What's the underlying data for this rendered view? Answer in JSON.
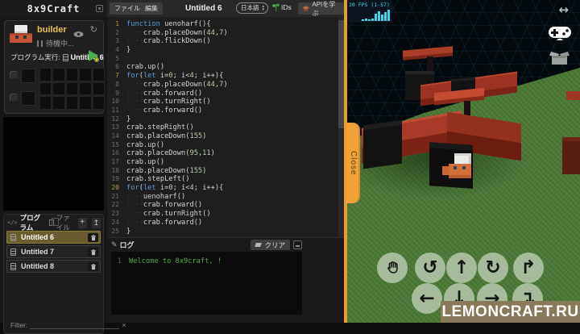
{
  "app": {
    "logo": "8x9Craft"
  },
  "menubar": {
    "file": "ファイル",
    "edit": "編集",
    "title": "Untitled 6",
    "language": "日本語",
    "ids": "IDs",
    "learn_api": "APIを学ぶ"
  },
  "sidebar": {
    "robot": {
      "name": "builder",
      "status": "待機中...",
      "refresh_glyph": "↻"
    },
    "run": {
      "label": "プログラム実行:",
      "program": "Untitled 6"
    },
    "panel": {
      "code_glyph": "</>",
      "tab_program": "プログラム",
      "tab_file": "ファイル",
      "add_label": "+",
      "upload_glyph": "↥",
      "programs": [
        {
          "name": "Untitled 6",
          "selected": true
        },
        {
          "name": "Untitled 7",
          "selected": false
        },
        {
          "name": "Untitled 8",
          "selected": false
        }
      ],
      "filter_label": "Filter:",
      "filter_clear": "×"
    }
  },
  "editor": {
    "lines": [
      {
        "n": 1,
        "hl": true,
        "t": [
          [
            "k",
            "function"
          ],
          [
            "t",
            " uenoharf(){"
          ]
        ]
      },
      {
        "n": 2,
        "t": [
          [
            "w",
            "····"
          ],
          [
            "t",
            "crab.placeDown("
          ],
          [
            "n",
            "44"
          ],
          [
            "t",
            ","
          ],
          [
            "n",
            "7"
          ],
          [
            "t",
            ")"
          ]
        ]
      },
      {
        "n": 3,
        "t": [
          [
            "w",
            "····"
          ],
          [
            "t",
            "crab.flickDown()"
          ]
        ]
      },
      {
        "n": 4,
        "t": [
          [
            "t",
            "}"
          ]
        ]
      },
      {
        "n": 5,
        "t": []
      },
      {
        "n": 6,
        "t": [
          [
            "t",
            "crab.up()"
          ]
        ]
      },
      {
        "n": 7,
        "hl": true,
        "t": [
          [
            "k",
            "for"
          ],
          [
            "t",
            "("
          ],
          [
            "k",
            "let"
          ],
          [
            "t",
            " i="
          ],
          [
            "n",
            "0"
          ],
          [
            "t",
            "; i<"
          ],
          [
            "n",
            "4"
          ],
          [
            "t",
            "; i++){"
          ]
        ]
      },
      {
        "n": 8,
        "t": [
          [
            "w",
            "····"
          ],
          [
            "t",
            "crab.placeDown("
          ],
          [
            "n",
            "44"
          ],
          [
            "t",
            ","
          ],
          [
            "n",
            "7"
          ],
          [
            "t",
            ")"
          ]
        ]
      },
      {
        "n": 9,
        "t": [
          [
            "w",
            "····"
          ],
          [
            "t",
            "crab.forward()"
          ]
        ]
      },
      {
        "n": 10,
        "t": [
          [
            "w",
            "····"
          ],
          [
            "t",
            "crab.turnRight()"
          ]
        ]
      },
      {
        "n": 11,
        "t": [
          [
            "w",
            "····"
          ],
          [
            "t",
            "crab.forward()"
          ]
        ]
      },
      {
        "n": 12,
        "t": [
          [
            "t",
            "}"
          ]
        ]
      },
      {
        "n": 13,
        "t": [
          [
            "t",
            "crab.stepRight()"
          ]
        ]
      },
      {
        "n": 14,
        "t": [
          [
            "t",
            "crab.placeDown("
          ],
          [
            "n",
            "155"
          ],
          [
            "t",
            ")"
          ]
        ]
      },
      {
        "n": 15,
        "t": [
          [
            "t",
            "crab.up()"
          ]
        ]
      },
      {
        "n": 16,
        "t": [
          [
            "t",
            "crab.placeDown("
          ],
          [
            "n",
            "95"
          ],
          [
            "t",
            ","
          ],
          [
            "n",
            "11"
          ],
          [
            "t",
            ")"
          ]
        ]
      },
      {
        "n": 17,
        "t": [
          [
            "t",
            "crab.up()"
          ]
        ]
      },
      {
        "n": 18,
        "t": [
          [
            "t",
            "crab.placeDown("
          ],
          [
            "n",
            "155"
          ],
          [
            "t",
            ")"
          ]
        ]
      },
      {
        "n": 19,
        "t": [
          [
            "t",
            "crab.stepLeft()"
          ]
        ]
      },
      {
        "n": 20,
        "hl": true,
        "t": [
          [
            "k",
            "for"
          ],
          [
            "t",
            "("
          ],
          [
            "k",
            "let"
          ],
          [
            "t",
            " i="
          ],
          [
            "n",
            "0"
          ],
          [
            "t",
            "; i<"
          ],
          [
            "n",
            "4"
          ],
          [
            "t",
            "; i++){"
          ]
        ]
      },
      {
        "n": 21,
        "t": [
          [
            "w",
            "····"
          ],
          [
            "t",
            "uenoharf()"
          ]
        ]
      },
      {
        "n": 22,
        "t": [
          [
            "w",
            "····"
          ],
          [
            "t",
            "crab.forward()"
          ]
        ]
      },
      {
        "n": 23,
        "t": [
          [
            "w",
            "····"
          ],
          [
            "t",
            "crab.turnRight()"
          ]
        ]
      },
      {
        "n": 24,
        "t": [
          [
            "w",
            "····"
          ],
          [
            "t",
            "crab.forward()"
          ]
        ]
      },
      {
        "n": 25,
        "t": [
          [
            "t",
            "}"
          ]
        ]
      }
    ]
  },
  "log": {
    "title": "ログ",
    "pencil_glyph": "✎",
    "clear": "クリア",
    "entries": [
      {
        "n": "1",
        "text": "Welcome to 8x9craft, !"
      }
    ]
  },
  "game": {
    "fps": "20 FPS (1-57)",
    "fps_bars": [
      2,
      3,
      2,
      3,
      9,
      12,
      8,
      11,
      14
    ],
    "resize_glyph": "↔",
    "close": "Close",
    "watermark": "LEMONCRAFT.RU",
    "controls_row1": [
      {
        "name": "hand",
        "glyph": ""
      },
      {
        "name": "rotate-left",
        "glyph": "↺"
      },
      {
        "name": "move-up",
        "glyph": "↑"
      },
      {
        "name": "rotate-right",
        "glyph": "↻"
      },
      {
        "name": "step-up",
        "glyph": "↱"
      }
    ],
    "controls_row2": [
      {
        "name": "move-left",
        "glyph": "←"
      },
      {
        "name": "move-down",
        "glyph": "↓"
      },
      {
        "name": "move-right",
        "glyph": "→"
      },
      {
        "name": "step-down",
        "glyph": "↴"
      }
    ]
  },
  "colors": {
    "accent": "#ef9b28",
    "selected_row": "#6a5c2e",
    "log_green": "#57a64a",
    "keyword_blue": "#569cd6",
    "number_green": "#b5cea8"
  }
}
